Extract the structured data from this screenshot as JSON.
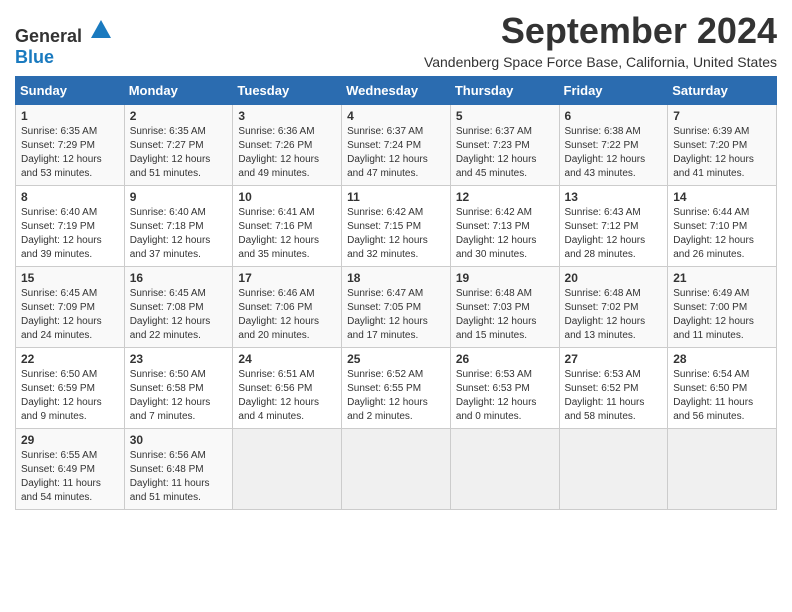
{
  "header": {
    "logo_general": "General",
    "logo_blue": "Blue",
    "title": "September 2024",
    "subtitle": "Vandenberg Space Force Base, California, United States"
  },
  "calendar": {
    "days_of_week": [
      "Sunday",
      "Monday",
      "Tuesday",
      "Wednesday",
      "Thursday",
      "Friday",
      "Saturday"
    ],
    "weeks": [
      [
        {
          "day": "",
          "info": ""
        },
        {
          "day": "2",
          "info": "Sunrise: 6:35 AM\nSunset: 7:27 PM\nDaylight: 12 hours\nand 51 minutes."
        },
        {
          "day": "3",
          "info": "Sunrise: 6:36 AM\nSunset: 7:26 PM\nDaylight: 12 hours\nand 49 minutes."
        },
        {
          "day": "4",
          "info": "Sunrise: 6:37 AM\nSunset: 7:24 PM\nDaylight: 12 hours\nand 47 minutes."
        },
        {
          "day": "5",
          "info": "Sunrise: 6:37 AM\nSunset: 7:23 PM\nDaylight: 12 hours\nand 45 minutes."
        },
        {
          "day": "6",
          "info": "Sunrise: 6:38 AM\nSunset: 7:22 PM\nDaylight: 12 hours\nand 43 minutes."
        },
        {
          "day": "7",
          "info": "Sunrise: 6:39 AM\nSunset: 7:20 PM\nDaylight: 12 hours\nand 41 minutes."
        }
      ],
      [
        {
          "day": "1",
          "info": "Sunrise: 6:35 AM\nSunset: 7:29 PM\nDaylight: 12 hours\nand 53 minutes.",
          "is_first_row_sunday": true
        },
        {
          "day": "8",
          "info": "Sunrise: 6:40 AM\nSunset: 7:19 PM\nDaylight: 12 hours\nand 39 minutes."
        },
        {
          "day": "9",
          "info": "Sunrise: 6:40 AM\nSunset: 7:18 PM\nDaylight: 12 hours\nand 37 minutes."
        },
        {
          "day": "10",
          "info": "Sunrise: 6:41 AM\nSunset: 7:16 PM\nDaylight: 12 hours\nand 35 minutes."
        },
        {
          "day": "11",
          "info": "Sunrise: 6:42 AM\nSunset: 7:15 PM\nDaylight: 12 hours\nand 32 minutes."
        },
        {
          "day": "12",
          "info": "Sunrise: 6:42 AM\nSunset: 7:13 PM\nDaylight: 12 hours\nand 30 minutes."
        },
        {
          "day": "13",
          "info": "Sunrise: 6:43 AM\nSunset: 7:12 PM\nDaylight: 12 hours\nand 28 minutes."
        },
        {
          "day": "14",
          "info": "Sunrise: 6:44 AM\nSunset: 7:10 PM\nDaylight: 12 hours\nand 26 minutes."
        }
      ],
      [
        {
          "day": "15",
          "info": "Sunrise: 6:45 AM\nSunset: 7:09 PM\nDaylight: 12 hours\nand 24 minutes."
        },
        {
          "day": "16",
          "info": "Sunrise: 6:45 AM\nSunset: 7:08 PM\nDaylight: 12 hours\nand 22 minutes."
        },
        {
          "day": "17",
          "info": "Sunrise: 6:46 AM\nSunset: 7:06 PM\nDaylight: 12 hours\nand 20 minutes."
        },
        {
          "day": "18",
          "info": "Sunrise: 6:47 AM\nSunset: 7:05 PM\nDaylight: 12 hours\nand 17 minutes."
        },
        {
          "day": "19",
          "info": "Sunrise: 6:48 AM\nSunset: 7:03 PM\nDaylight: 12 hours\nand 15 minutes."
        },
        {
          "day": "20",
          "info": "Sunrise: 6:48 AM\nSunset: 7:02 PM\nDaylight: 12 hours\nand 13 minutes."
        },
        {
          "day": "21",
          "info": "Sunrise: 6:49 AM\nSunset: 7:00 PM\nDaylight: 12 hours\nand 11 minutes."
        }
      ],
      [
        {
          "day": "22",
          "info": "Sunrise: 6:50 AM\nSunset: 6:59 PM\nDaylight: 12 hours\nand 9 minutes."
        },
        {
          "day": "23",
          "info": "Sunrise: 6:50 AM\nSunset: 6:58 PM\nDaylight: 12 hours\nand 7 minutes."
        },
        {
          "day": "24",
          "info": "Sunrise: 6:51 AM\nSunset: 6:56 PM\nDaylight: 12 hours\nand 4 minutes."
        },
        {
          "day": "25",
          "info": "Sunrise: 6:52 AM\nSunset: 6:55 PM\nDaylight: 12 hours\nand 2 minutes."
        },
        {
          "day": "26",
          "info": "Sunrise: 6:53 AM\nSunset: 6:53 PM\nDaylight: 12 hours\nand 0 minutes."
        },
        {
          "day": "27",
          "info": "Sunrise: 6:53 AM\nSunset: 6:52 PM\nDaylight: 11 hours\nand 58 minutes."
        },
        {
          "day": "28",
          "info": "Sunrise: 6:54 AM\nSunset: 6:50 PM\nDaylight: 11 hours\nand 56 minutes."
        }
      ],
      [
        {
          "day": "29",
          "info": "Sunrise: 6:55 AM\nSunset: 6:49 PM\nDaylight: 11 hours\nand 54 minutes."
        },
        {
          "day": "30",
          "info": "Sunrise: 6:56 AM\nSunset: 6:48 PM\nDaylight: 11 hours\nand 51 minutes."
        },
        {
          "day": "",
          "info": ""
        },
        {
          "day": "",
          "info": ""
        },
        {
          "day": "",
          "info": ""
        },
        {
          "day": "",
          "info": ""
        },
        {
          "day": "",
          "info": ""
        }
      ]
    ]
  }
}
